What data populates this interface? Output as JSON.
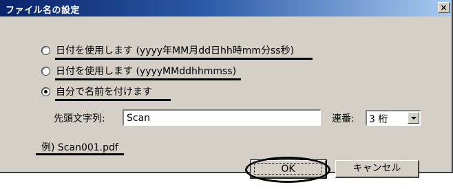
{
  "dialog": {
    "title": "ファイル名の設定",
    "close_label": "×"
  },
  "options": [
    {
      "label": "日付を使用します (yyyy年MM月dd日hh時mm分ss秒)",
      "checked": false
    },
    {
      "label": "日付を使用します (yyyyMMddhhmmss)",
      "checked": false
    },
    {
      "label": "自分で名前を付けます",
      "checked": true
    }
  ],
  "prefix": {
    "label": "先頭文字列:",
    "value": "Scan"
  },
  "serial": {
    "label": "連番:",
    "value": "3 桁"
  },
  "example": {
    "text": "例) Scan001.pdf"
  },
  "buttons": {
    "ok": "OK",
    "cancel": "キャンセル"
  }
}
